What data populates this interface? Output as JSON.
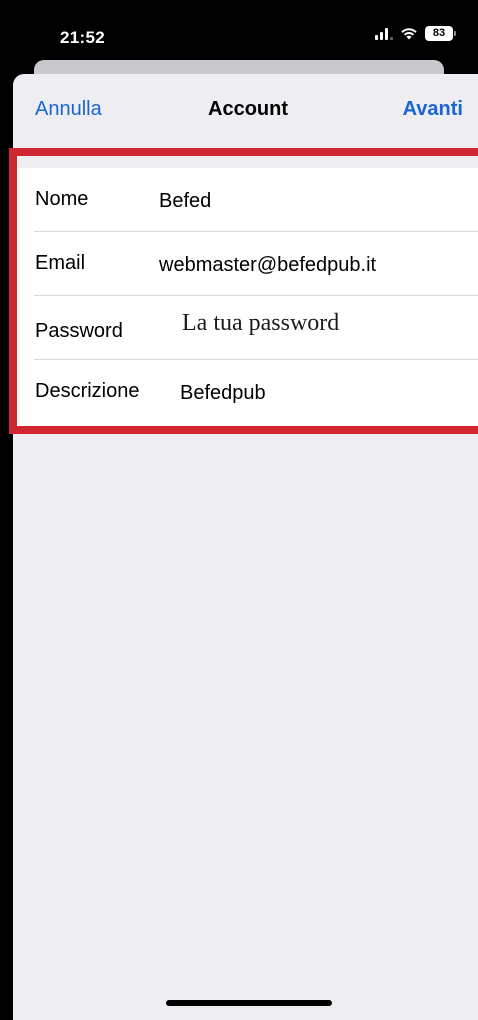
{
  "status_bar": {
    "time": "21:52",
    "battery": "83"
  },
  "nav": {
    "cancel": "Annulla",
    "title": "Account",
    "next": "Avanti"
  },
  "form": {
    "rows": [
      {
        "label": "Nome",
        "value": "Befed"
      },
      {
        "label": "Email",
        "value": "webmaster@befedpub.it"
      },
      {
        "label": "Password",
        "placeholder": "La tua password"
      },
      {
        "label": "Descrizione",
        "value": "Befedpub"
      }
    ]
  },
  "colors": {
    "accent": "#1a65d3",
    "highlight": "#d02631",
    "background": "#eeedf2"
  }
}
